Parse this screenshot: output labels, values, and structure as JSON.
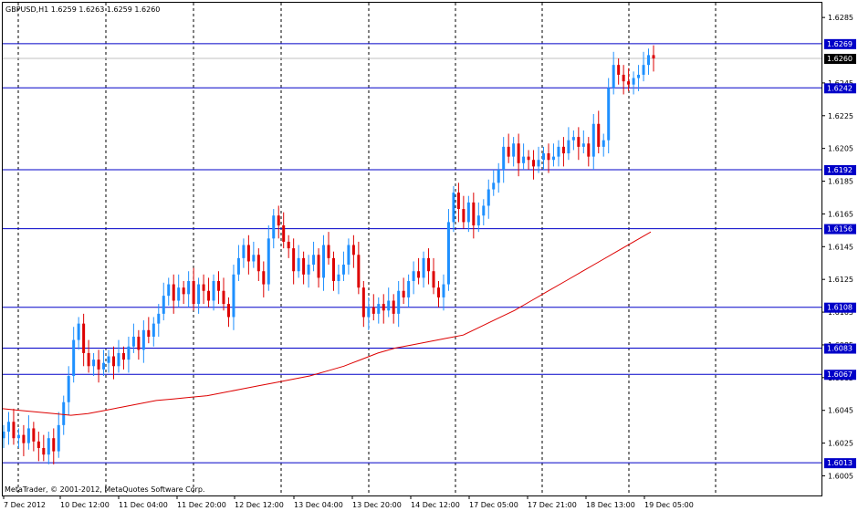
{
  "symbol_header": "GBPUSD,H1  1.6259 1.6263 1.6259 1.6260",
  "copyright": "MetaTrader, © 2001-2012, MetaQuotes Software Corp.",
  "colors": {
    "background": "#ffffff",
    "bull_candle": "#1e90ff",
    "bear_candle": "#dd0000",
    "moving_average": "#dd0000",
    "level_lines": "#0000c8",
    "bid_line": "#c0c0c0",
    "label_bg": "#0000c8",
    "bid_label_bg": "#000000",
    "grid": "#000000"
  },
  "chart_data": {
    "type": "candlestick",
    "ylim": [
      1.6,
      1.629
    ],
    "y_ticks": [
      "1.6285",
      "1.6245",
      "1.6225",
      "1.6205",
      "1.6185",
      "1.6165",
      "1.6145",
      "1.6125",
      "1.6105",
      "1.6085",
      "1.6065",
      "1.6045",
      "1.6025",
      "1.6005"
    ],
    "x_tick_labels": [
      "7 Dec 2012",
      "10 Dec 12:00",
      "11 Dec 04:00",
      "11 Dec 20:00",
      "12 Dec 12:00",
      "13 Dec 04:00",
      "13 Dec 20:00",
      "14 Dec 12:00",
      "17 Dec 05:00",
      "17 Dec 21:00",
      "18 Dec 13:00",
      "19 Dec 05:00"
    ],
    "horizontal_levels": [
      "1.6269",
      "1.6242",
      "1.6192",
      "1.6156",
      "1.6108",
      "1.6083",
      "1.6067",
      "1.6013"
    ],
    "bid_line": "1.6260",
    "series": [
      {
        "name": "close",
        "values": [
          1.6032,
          1.6038,
          1.6028,
          1.603,
          1.6025,
          1.6034,
          1.6026,
          1.6022,
          1.6018,
          1.6028,
          1.602,
          1.6036,
          1.605,
          1.6066,
          1.6088,
          1.6098,
          1.608,
          1.6072,
          1.6076,
          1.607,
          1.6074,
          1.6078,
          1.6072,
          1.608,
          1.6076,
          1.6084,
          1.609,
          1.6082,
          1.6094,
          1.609,
          1.6098,
          1.6104,
          1.6115,
          1.6122,
          1.6112,
          1.612,
          1.6116,
          1.6124,
          1.611,
          1.6122,
          1.6118,
          1.6112,
          1.6124,
          1.6118,
          1.611,
          1.6102,
          1.6128,
          1.6138,
          1.6146,
          1.6136,
          1.614,
          1.613,
          1.6122,
          1.615,
          1.6164,
          1.6158,
          1.6148,
          1.6144,
          1.613,
          1.6138,
          1.6128,
          1.6134,
          1.614,
          1.6126,
          1.6146,
          1.6138,
          1.6124,
          1.6128,
          1.6134,
          1.6146,
          1.614,
          1.612,
          1.6102,
          1.6108,
          1.6104,
          1.611,
          1.6106,
          1.6112,
          1.6104,
          1.6118,
          1.6114,
          1.6124,
          1.613,
          1.6126,
          1.6138,
          1.613,
          1.612,
          1.6114,
          1.6122,
          1.616,
          1.6178,
          1.6168,
          1.616,
          1.6172,
          1.6158,
          1.6164,
          1.617,
          1.618,
          1.6184,
          1.6192,
          1.6206,
          1.62,
          1.6208,
          1.6196,
          1.62,
          1.6198,
          1.6194,
          1.6198,
          1.6202,
          1.6198,
          1.62,
          1.6206,
          1.6202,
          1.621,
          1.6212,
          1.6206,
          1.6208,
          1.62,
          1.622,
          1.6206,
          1.621,
          1.6242,
          1.6256,
          1.625,
          1.6246,
          1.6244,
          1.6248,
          1.625,
          1.6256,
          1.6262,
          1.626
        ]
      },
      {
        "name": "moving_average",
        "values": [
          1.6046,
          1.6045,
          1.6044,
          1.6043,
          1.6042,
          1.6043,
          1.6045,
          1.6047,
          1.6049,
          1.6051,
          1.6052,
          1.6053,
          1.6054,
          1.6056,
          1.6058,
          1.606,
          1.6062,
          1.6064,
          1.6066,
          1.6069,
          1.6072,
          1.6076,
          1.608,
          1.6083,
          1.6085,
          1.6087,
          1.6089,
          1.6091,
          1.6096,
          1.6101,
          1.6106,
          1.6112,
          1.6118,
          1.6124,
          1.613,
          1.6136,
          1.6142,
          1.6148,
          1.6154
        ]
      }
    ]
  }
}
